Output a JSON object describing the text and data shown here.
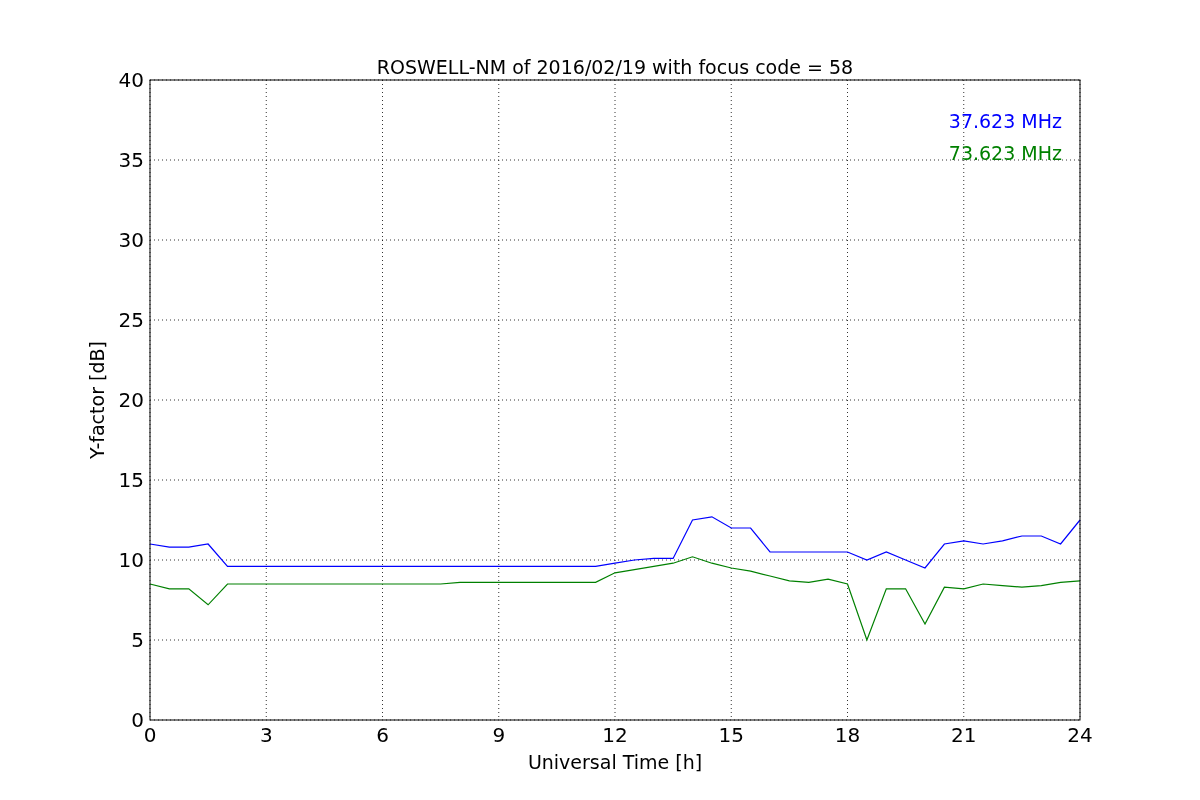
{
  "chart_data": {
    "type": "line",
    "title": "ROSWELL-NM of 2016/02/19 with focus code = 58",
    "xlabel": "Universal Time [h]",
    "ylabel": "Y-factor [dB]",
    "x": [
      0,
      0.5,
      1,
      1.5,
      2,
      2.5,
      3,
      3.5,
      4,
      4.5,
      5,
      5.5,
      6,
      6.5,
      7,
      7.5,
      8,
      8.5,
      9,
      9.5,
      10,
      10.5,
      11,
      11.5,
      12,
      12.5,
      13,
      13.5,
      14,
      14.5,
      15,
      15.5,
      16,
      16.5,
      17,
      17.5,
      18,
      18.5,
      19,
      19.5,
      20,
      20.5,
      21,
      21.5,
      22,
      22.5,
      23,
      23.5,
      24
    ],
    "series": [
      {
        "name": "37.623 MHz",
        "color": "#0000ff",
        "values": [
          11,
          10.8,
          10.8,
          11,
          9.6,
          9.6,
          9.6,
          9.6,
          9.6,
          9.6,
          9.6,
          9.6,
          9.6,
          9.6,
          9.6,
          9.6,
          9.6,
          9.6,
          9.6,
          9.6,
          9.6,
          9.6,
          9.6,
          9.6,
          9.8,
          10,
          10.1,
          10.1,
          12.5,
          12.7,
          12,
          12,
          10.5,
          10.5,
          10.5,
          10.5,
          10.5,
          10,
          10.5,
          10,
          9.5,
          11,
          11.2,
          11,
          11.2,
          11.5,
          11.5,
          11,
          12.5
        ]
      },
      {
        "name": "73.623 MHz",
        "color": "#008000",
        "values": [
          8.5,
          8.2,
          8.2,
          7.2,
          8.5,
          8.5,
          8.5,
          8.5,
          8.5,
          8.5,
          8.5,
          8.5,
          8.5,
          8.5,
          8.5,
          8.5,
          8.6,
          8.6,
          8.6,
          8.6,
          8.6,
          8.6,
          8.6,
          8.6,
          9.2,
          9.4,
          9.6,
          9.8,
          10.2,
          9.8,
          9.5,
          9.3,
          9,
          8.7,
          8.6,
          8.8,
          8.5,
          5,
          8.2,
          8.2,
          6,
          8.3,
          8.2,
          8.5,
          8.4,
          8.3,
          8.4,
          8.6,
          8.7
        ]
      }
    ],
    "xlim": [
      0,
      24
    ],
    "ylim": [
      0,
      40
    ],
    "xticks": [
      0,
      3,
      6,
      9,
      12,
      15,
      18,
      21,
      24
    ],
    "yticks": [
      0,
      5,
      10,
      15,
      20,
      25,
      30,
      35,
      40
    ],
    "grid": true
  }
}
